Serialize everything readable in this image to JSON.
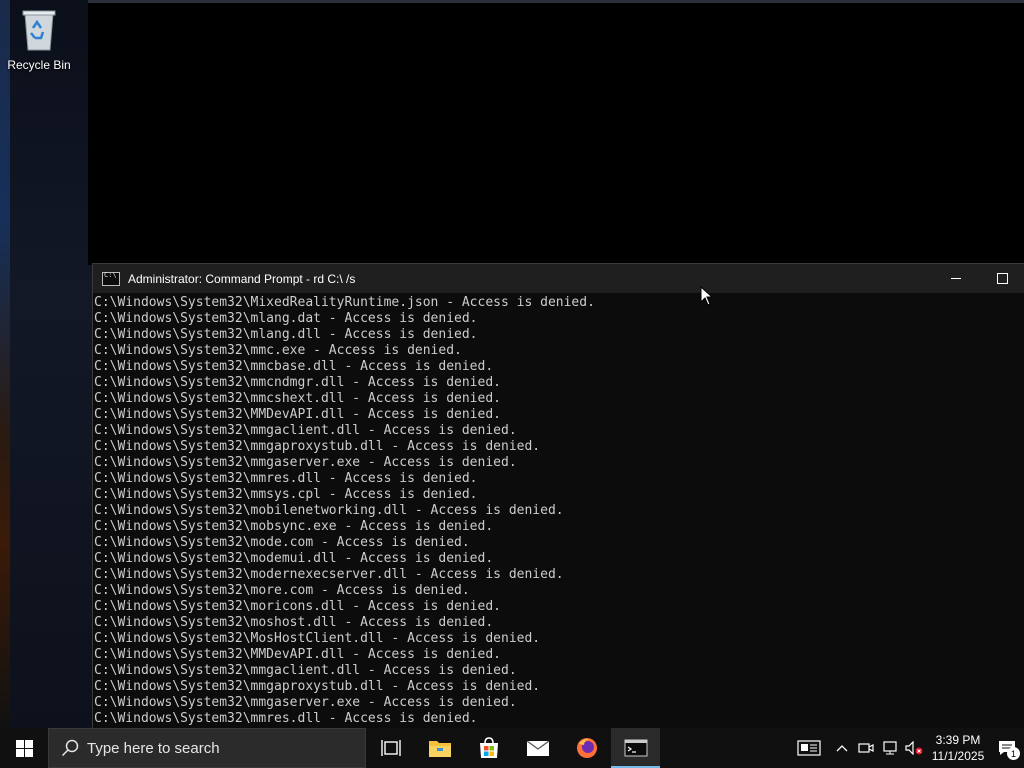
{
  "desktop": {
    "recycle_bin_label": "Recycle Bin"
  },
  "cmd_window": {
    "title": "Administrator: Command Prompt - rd  C:\\ /s",
    "lines": [
      "C:\\Windows\\System32\\MixedRealityRuntime.json - Access is denied.",
      "C:\\Windows\\System32\\mlang.dat - Access is denied.",
      "C:\\Windows\\System32\\mlang.dll - Access is denied.",
      "C:\\Windows\\System32\\mmc.exe - Access is denied.",
      "C:\\Windows\\System32\\mmcbase.dll - Access is denied.",
      "C:\\Windows\\System32\\mmcndmgr.dll - Access is denied.",
      "C:\\Windows\\System32\\mmcshext.dll - Access is denied.",
      "C:\\Windows\\System32\\MMDevAPI.dll - Access is denied.",
      "C:\\Windows\\System32\\mmgaclient.dll - Access is denied.",
      "C:\\Windows\\System32\\mmgaproxystub.dll - Access is denied.",
      "C:\\Windows\\System32\\mmgaserver.exe - Access is denied.",
      "C:\\Windows\\System32\\mmres.dll - Access is denied.",
      "C:\\Windows\\System32\\mmsys.cpl - Access is denied.",
      "C:\\Windows\\System32\\mobilenetworking.dll - Access is denied.",
      "C:\\Windows\\System32\\mobsync.exe - Access is denied.",
      "C:\\Windows\\System32\\mode.com - Access is denied.",
      "C:\\Windows\\System32\\modemui.dll - Access is denied.",
      "C:\\Windows\\System32\\modernexecserver.dll - Access is denied.",
      "C:\\Windows\\System32\\more.com - Access is denied.",
      "C:\\Windows\\System32\\moricons.dll - Access is denied.",
      "C:\\Windows\\System32\\moshost.dll - Access is denied.",
      "C:\\Windows\\System32\\MosHostClient.dll - Access is denied.",
      "C:\\Windows\\System32\\MMDevAPI.dll - Access is denied.",
      "C:\\Windows\\System32\\mmgaclient.dll - Access is denied.",
      "C:\\Windows\\System32\\mmgaproxystub.dll - Access is denied.",
      "C:\\Windows\\System32\\mmgaserver.exe - Access is denied.",
      "C:\\Windows\\System32\\mmres.dll - Access is denied."
    ]
  },
  "taskbar": {
    "search_placeholder": "Type here to search",
    "clock_time": "3:39 PM",
    "clock_date": "11/1/2025",
    "notification_count": "1",
    "accent_color": "#76b9ed"
  },
  "icons": {
    "start": "windows-logo-icon",
    "search": "search-icon",
    "task_view": "task-view-icon",
    "file_explorer": "folder-icon",
    "store": "store-icon",
    "mail": "mail-icon",
    "firefox": "firefox-icon",
    "cmd": "command-prompt-icon"
  }
}
